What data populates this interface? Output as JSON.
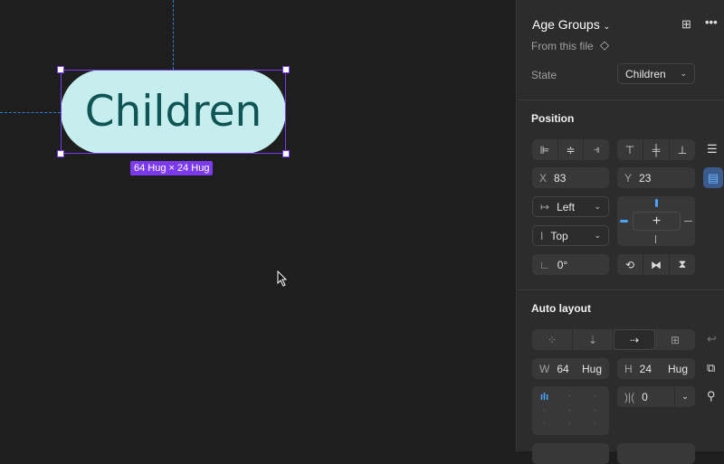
{
  "canvas": {
    "component_text": "Children",
    "size_label": "64 Hug × 24 Hug"
  },
  "panel": {
    "component": {
      "name": "Age Groups",
      "source": "From this file",
      "state_label": "State",
      "state_value": "Children"
    },
    "position": {
      "title": "Position",
      "x_label": "X",
      "x": "83",
      "y_label": "Y",
      "y": "23",
      "h_constraint": "Left",
      "v_constraint": "Top",
      "rotation": "0°"
    },
    "auto_layout": {
      "title": "Auto layout",
      "w_label": "W",
      "w": "64",
      "w_mode": "Hug",
      "h_label": "H",
      "h": "24",
      "h_mode": "Hug",
      "gap": "0",
      "selected_direction": "horizontal"
    }
  },
  "colors": {
    "selection": "#7c3aed",
    "component_fill": "#c6eeee",
    "accent": "#4aa3ff"
  }
}
